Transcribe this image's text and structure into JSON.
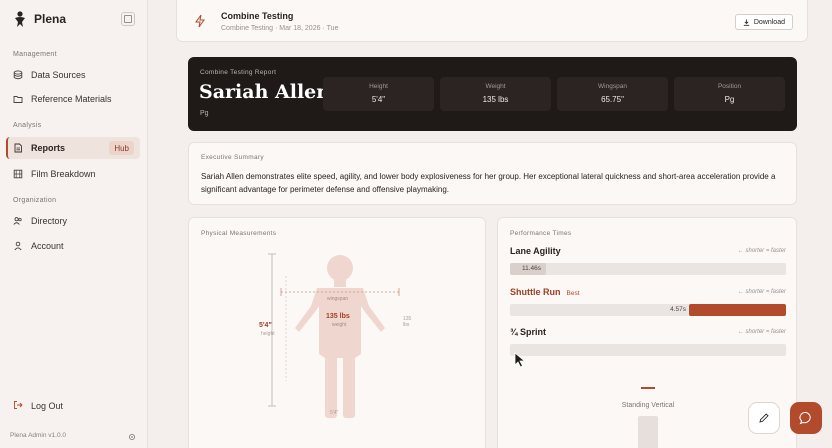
{
  "app": {
    "name": "Plena",
    "version": "Plena Admin v1.0.0"
  },
  "sidebar": {
    "sections": [
      {
        "label": "Management"
      },
      {
        "label": "Analysis"
      },
      {
        "label": "Organization"
      }
    ],
    "items": [
      {
        "label": "Data Sources",
        "icon": "database-icon"
      },
      {
        "label": "Reference Materials",
        "icon": "folder-icon"
      },
      {
        "label": "Reports",
        "icon": "document-icon",
        "badge": "Hub",
        "active": true
      },
      {
        "label": "Film Breakdown",
        "icon": "film-icon"
      },
      {
        "label": "Directory",
        "icon": "users-icon"
      },
      {
        "label": "Account",
        "icon": "user-icon"
      }
    ],
    "logout": "Log Out"
  },
  "header": {
    "title": "Combine Testing",
    "subtitle": "Combine Testing · Mar 18, 2026 · Tue",
    "download_label": "Download"
  },
  "report": {
    "overline": "Combine Testing Report",
    "athlete_name": "Sariah Allen",
    "position_short": "Pg",
    "stats": [
      {
        "label": "Height",
        "value": "5'4\""
      },
      {
        "label": "Weight",
        "value": "135 lbs"
      },
      {
        "label": "Wingspan",
        "value": "65.75\""
      },
      {
        "label": "Position",
        "value": "Pg"
      }
    ]
  },
  "summary": {
    "label": "Executive Summary",
    "text": "Sariah Allen demonstrates elite speed, agility, and lower body explosiveness for her group. Her exceptional lateral quickness and short-area acceleration provide a significant advantage for perimeter defense and offensive playmaking."
  },
  "physical": {
    "label": "Physical Measurements",
    "height_label": "5'4\"",
    "height_sub": "height",
    "weight_label": "135 lbs",
    "weight_sub": "weight",
    "wingspan_label": "wingspan",
    "right_label": "135",
    "right_sub": "lbs",
    "bottom_label": "5'4\""
  },
  "performance": {
    "label": "Performance Times",
    "tests": [
      {
        "name": "Lane Agility",
        "hint": "← shorter = faster",
        "value": "11.46s",
        "fraction": 0.13,
        "best": false
      },
      {
        "name": "Shuttle Run",
        "best_tag": "Best",
        "hint": "← shorter = faster",
        "value": "4.57s",
        "fraction": 0.35,
        "best": true
      },
      {
        "name": "¾ Sprint",
        "hint": "← shorter = faster",
        "value": "",
        "fraction": 0,
        "best": false
      }
    ],
    "vertical_label": "Standing Vertical"
  },
  "colors": {
    "accent": "#b24a2c",
    "hero_bg": "#1f1917",
    "page_bg": "#f4efec"
  }
}
